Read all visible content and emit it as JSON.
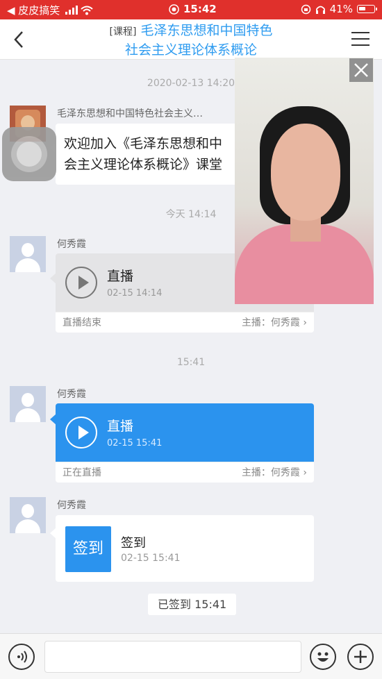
{
  "status_bar": {
    "carrier": "◀ 皮皮搞笑",
    "time": "15:42",
    "battery": "41%"
  },
  "header": {
    "tag": "[课程]",
    "title_line1": "毛泽东思想和中国特色",
    "title_line2": "社会主义理论体系概论"
  },
  "messages": {
    "time1": "2020-02-13 14:20",
    "welcome_sender": "毛泽东思想和中国特色社会主义…",
    "welcome_line1": "欢迎加入《毛泽东思想和中",
    "welcome_line2": "会主义理论体系概论》课堂",
    "time2": "今天 14:14",
    "msg1_sender": "何秀霞",
    "msg1_title": "直播",
    "msg1_date": "02-15 14:14",
    "msg1_status": "直播结束",
    "msg1_host": "主播：何秀霞 ›",
    "time3": "15:41",
    "msg2_sender": "何秀霞",
    "msg2_title": "直播",
    "msg2_date": "02-15 15:41",
    "msg2_status": "正在直播",
    "msg2_host": "主播：何秀霞 ›",
    "msg3_sender": "何秀霞",
    "msg3_button": "签到",
    "msg3_title": "签到",
    "msg3_date": "02-15 15:41",
    "signed_notice": "已签到 15:41"
  },
  "colors": {
    "status_bar": "#e0302c",
    "accent": "#2b93ee",
    "title": "#2f9cf0"
  }
}
